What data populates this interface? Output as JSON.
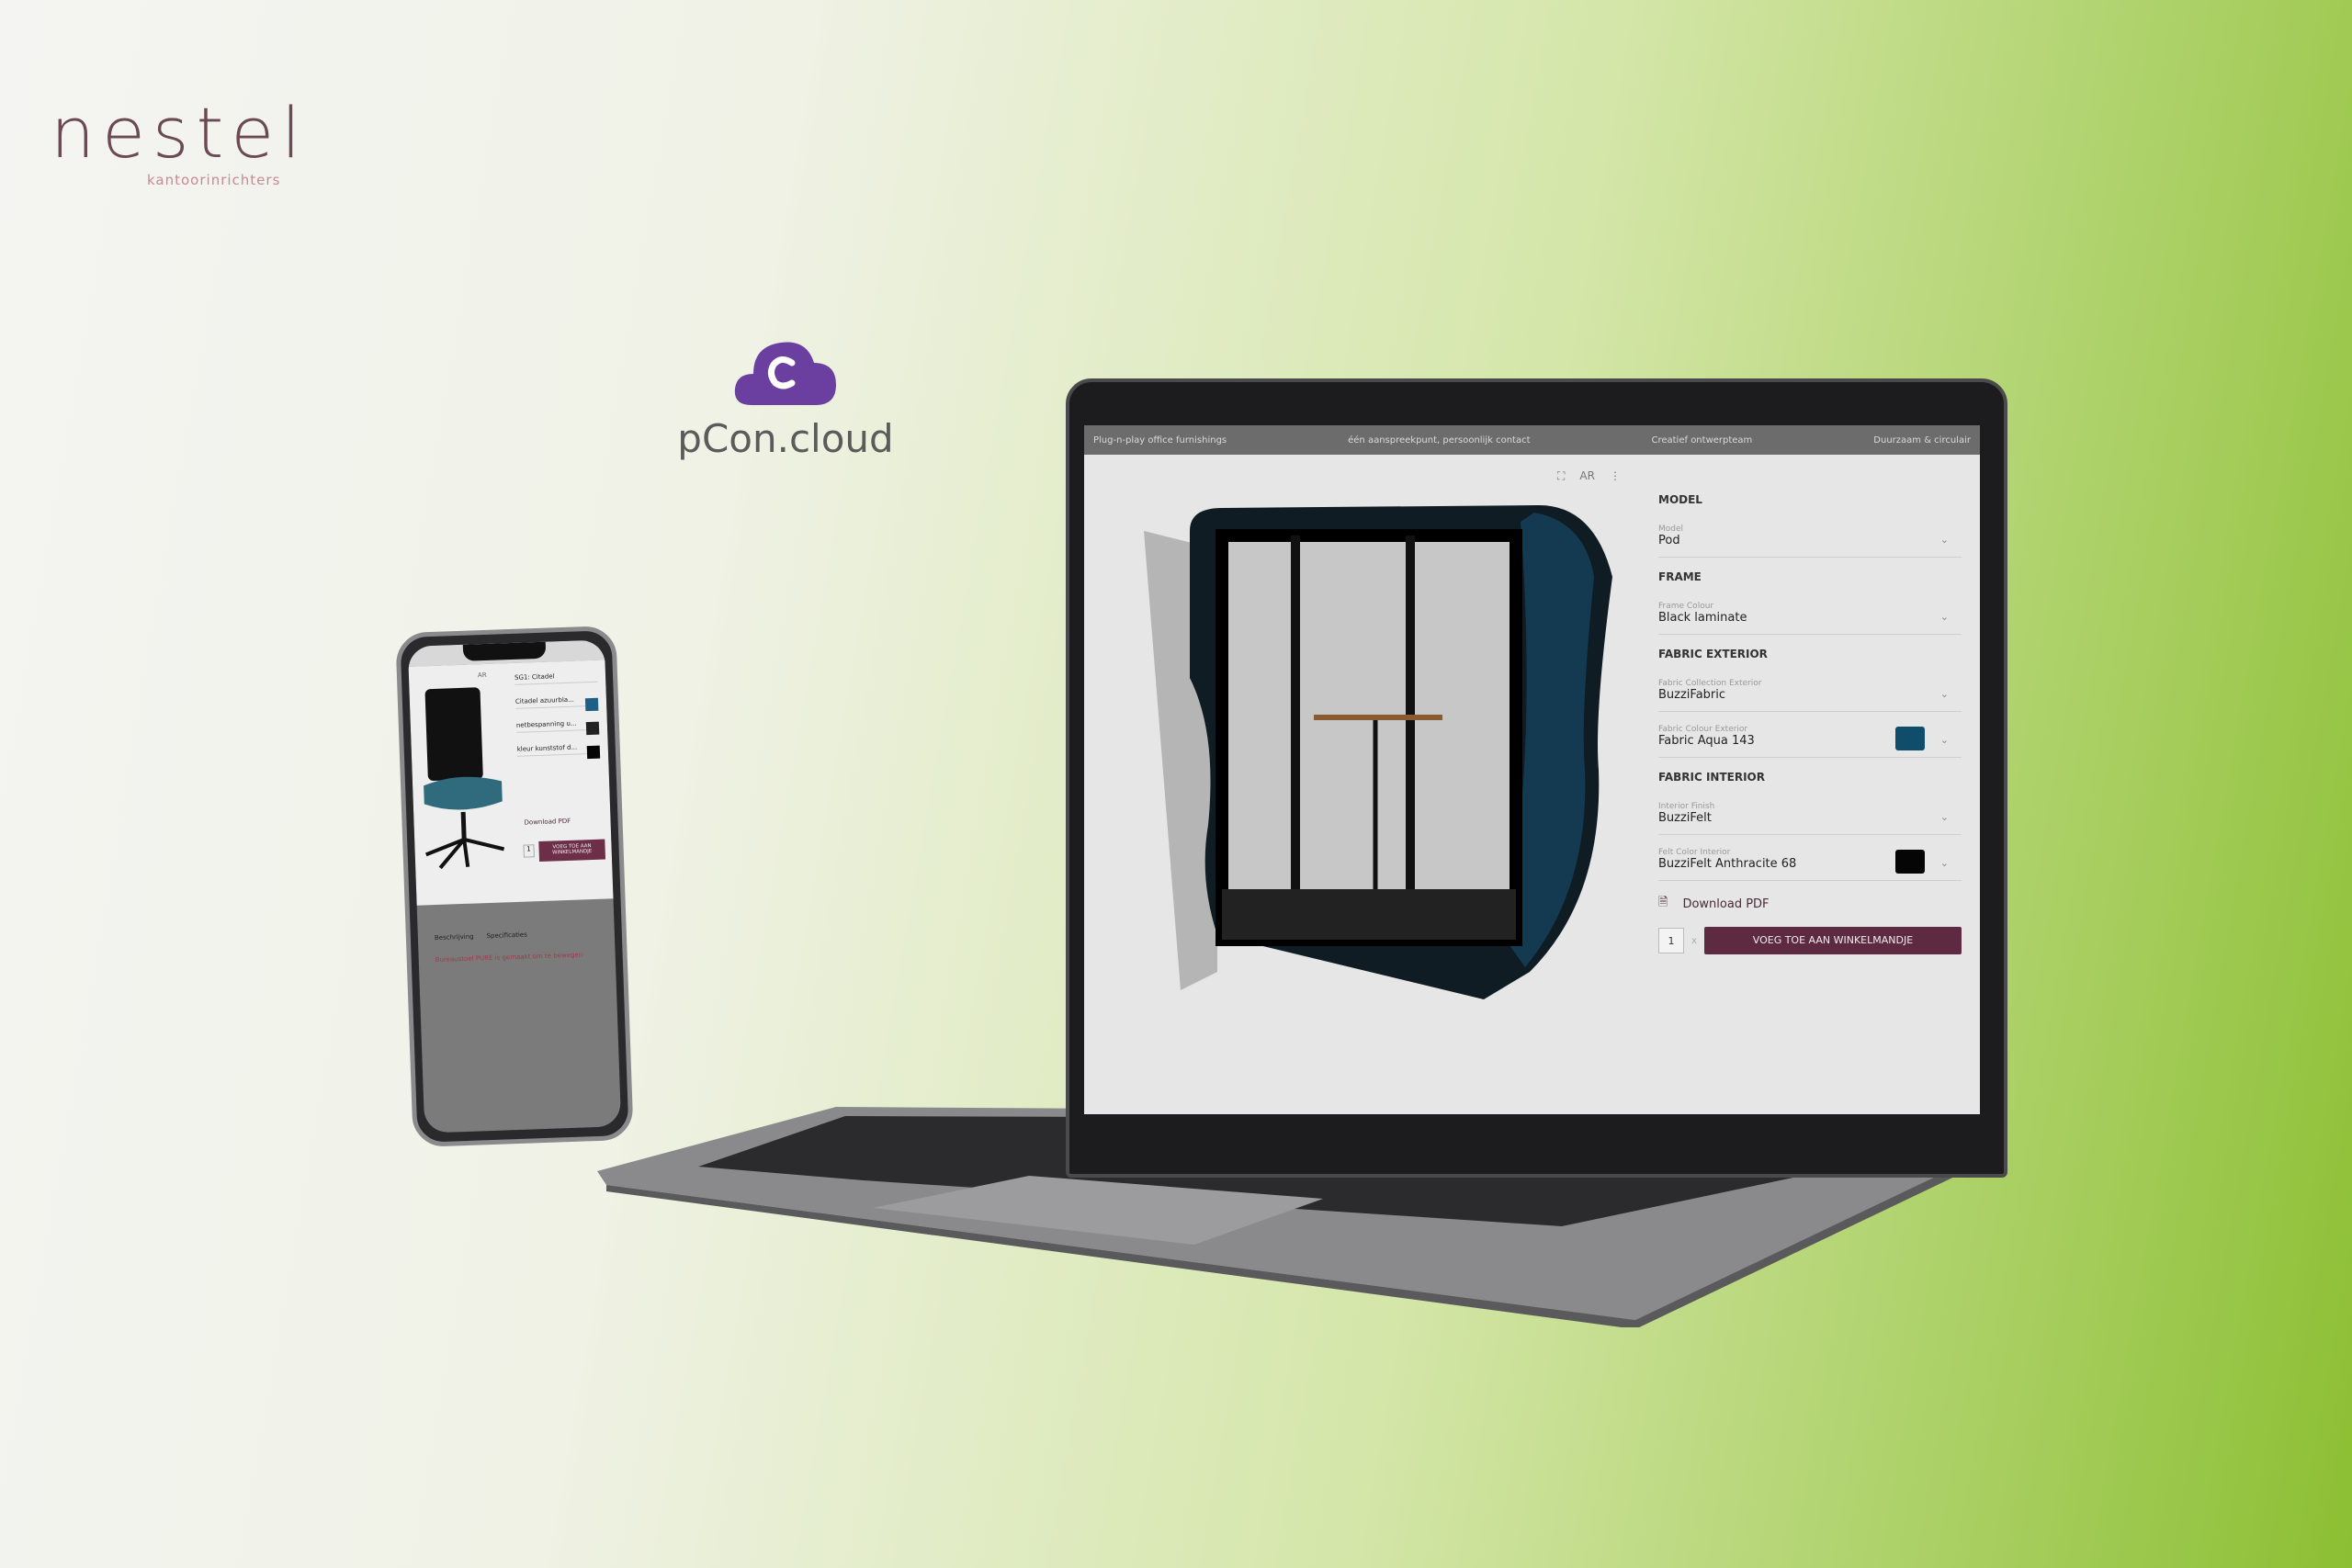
{
  "brand": {
    "logo_text": "nestel",
    "logo_subtitle": "kantoorinrichters",
    "partner_name": "pCon.cloud",
    "partner_color": "#6a3fa0"
  },
  "laptop": {
    "topbar": [
      "Plug-n-play office furnishings",
      "één aanspreekpunt, persoonlijk contact",
      "Creatief ontwerpteam",
      "Duurzaam & circulair"
    ],
    "viewer_tools": {
      "fullscreen_icon": "fullscreen-icon",
      "ar_label": "AR",
      "more_icon": "more-vertical-icon"
    },
    "panel": {
      "sections": [
        {
          "title": "MODEL",
          "fields": [
            {
              "label": "Model",
              "value": "Pod"
            }
          ]
        },
        {
          "title": "FRAME",
          "fields": [
            {
              "label": "Frame Colour",
              "value": "Black laminate"
            }
          ]
        },
        {
          "title": "FABRIC EXTERIOR",
          "fields": [
            {
              "label": "Fabric Collection Exterior",
              "value": "BuzziFabric"
            },
            {
              "label": "Fabric Colour Exterior",
              "value": "Fabric Aqua 143",
              "swatch": "#0f4d6b"
            }
          ]
        },
        {
          "title": "FABRIC INTERIOR",
          "fields": [
            {
              "label": "Interior Finish",
              "value": "BuzziFelt"
            },
            {
              "label": "Felt Color Interior",
              "value": "BuzziFelt Anthracite 68",
              "swatch": "#050505"
            }
          ]
        }
      ],
      "download_pdf": "Download PDF",
      "quantity": "1",
      "quantity_suffix": "x",
      "add_to_cart": "VOEG TOE AAN WINKELMANDJE",
      "accent": "#5e2a42"
    }
  },
  "phone": {
    "url": "citadel",
    "ar_label": "AR",
    "options": [
      {
        "value": "SG1: Citadel"
      },
      {
        "value": "Citadel azuurbla...",
        "swatch": "#1f5f85"
      },
      {
        "value": "netbespanning u...",
        "swatch": "#222222"
      },
      {
        "value": "kleur kunststof d...",
        "swatch": "#050505"
      }
    ],
    "download_pdf": "Download PDF",
    "quantity": "1",
    "add_to_cart": "VOEG TOE AAN WINKELMANDJE",
    "tabs": [
      "Beschrijving",
      "Specificaties"
    ],
    "heading": "Bureaustoel PURE is gemaakt om te bewegen"
  }
}
